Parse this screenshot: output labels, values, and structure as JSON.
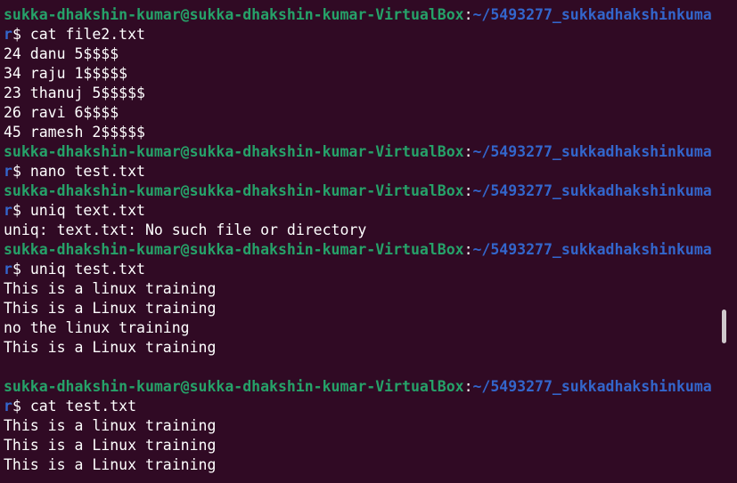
{
  "terminal": {
    "background": "#300a24",
    "user_host_color": "#26a269",
    "path_color": "#3366cc",
    "lines": [
      {
        "type": "prompt",
        "user_host": "sukka-dhakshin-kumar@sukka-dhakshin-kumar-VirtualBox",
        "sep": ":",
        "path": "~/5493277_sukkadhakshinkuma"
      },
      {
        "type": "command",
        "wrap": "r",
        "prompt": "$ ",
        "cmd": "cat file2.txt"
      },
      {
        "type": "output",
        "text": "24 danu 5$$$$"
      },
      {
        "type": "output",
        "text": "34 raju 1$$$$$"
      },
      {
        "type": "output",
        "text": "23 thanuj 5$$$$$"
      },
      {
        "type": "output",
        "text": "26 ravi 6$$$$"
      },
      {
        "type": "output",
        "text": "45 ramesh 2$$$$$"
      },
      {
        "type": "prompt",
        "user_host": "sukka-dhakshin-kumar@sukka-dhakshin-kumar-VirtualBox",
        "sep": ":",
        "path": "~/5493277_sukkadhakshinkuma"
      },
      {
        "type": "command",
        "wrap": "r",
        "prompt": "$ ",
        "cmd": "nano test.txt"
      },
      {
        "type": "prompt",
        "user_host": "sukka-dhakshin-kumar@sukka-dhakshin-kumar-VirtualBox",
        "sep": ":",
        "path": "~/5493277_sukkadhakshinkuma"
      },
      {
        "type": "command",
        "wrap": "r",
        "prompt": "$ ",
        "cmd": "uniq text.txt"
      },
      {
        "type": "output",
        "text": "uniq: text.txt: No such file or directory"
      },
      {
        "type": "prompt",
        "user_host": "sukka-dhakshin-kumar@sukka-dhakshin-kumar-VirtualBox",
        "sep": ":",
        "path": "~/5493277_sukkadhakshinkuma"
      },
      {
        "type": "command",
        "wrap": "r",
        "prompt": "$ ",
        "cmd": "uniq test.txt"
      },
      {
        "type": "output",
        "text": "This is a linux training"
      },
      {
        "type": "output",
        "text": "This is a Linux training"
      },
      {
        "type": "output",
        "text": "no the linux training"
      },
      {
        "type": "output",
        "text": "This is a Linux training"
      },
      {
        "type": "output",
        "text": ""
      },
      {
        "type": "prompt",
        "user_host": "sukka-dhakshin-kumar@sukka-dhakshin-kumar-VirtualBox",
        "sep": ":",
        "path": "~/5493277_sukkadhakshinkuma"
      },
      {
        "type": "command",
        "wrap": "r",
        "prompt": "$ ",
        "cmd": "cat test.txt"
      },
      {
        "type": "output",
        "text": "This is a linux training"
      },
      {
        "type": "output",
        "text": "This is a Linux training"
      },
      {
        "type": "output",
        "text": "This is a Linux training"
      }
    ]
  }
}
